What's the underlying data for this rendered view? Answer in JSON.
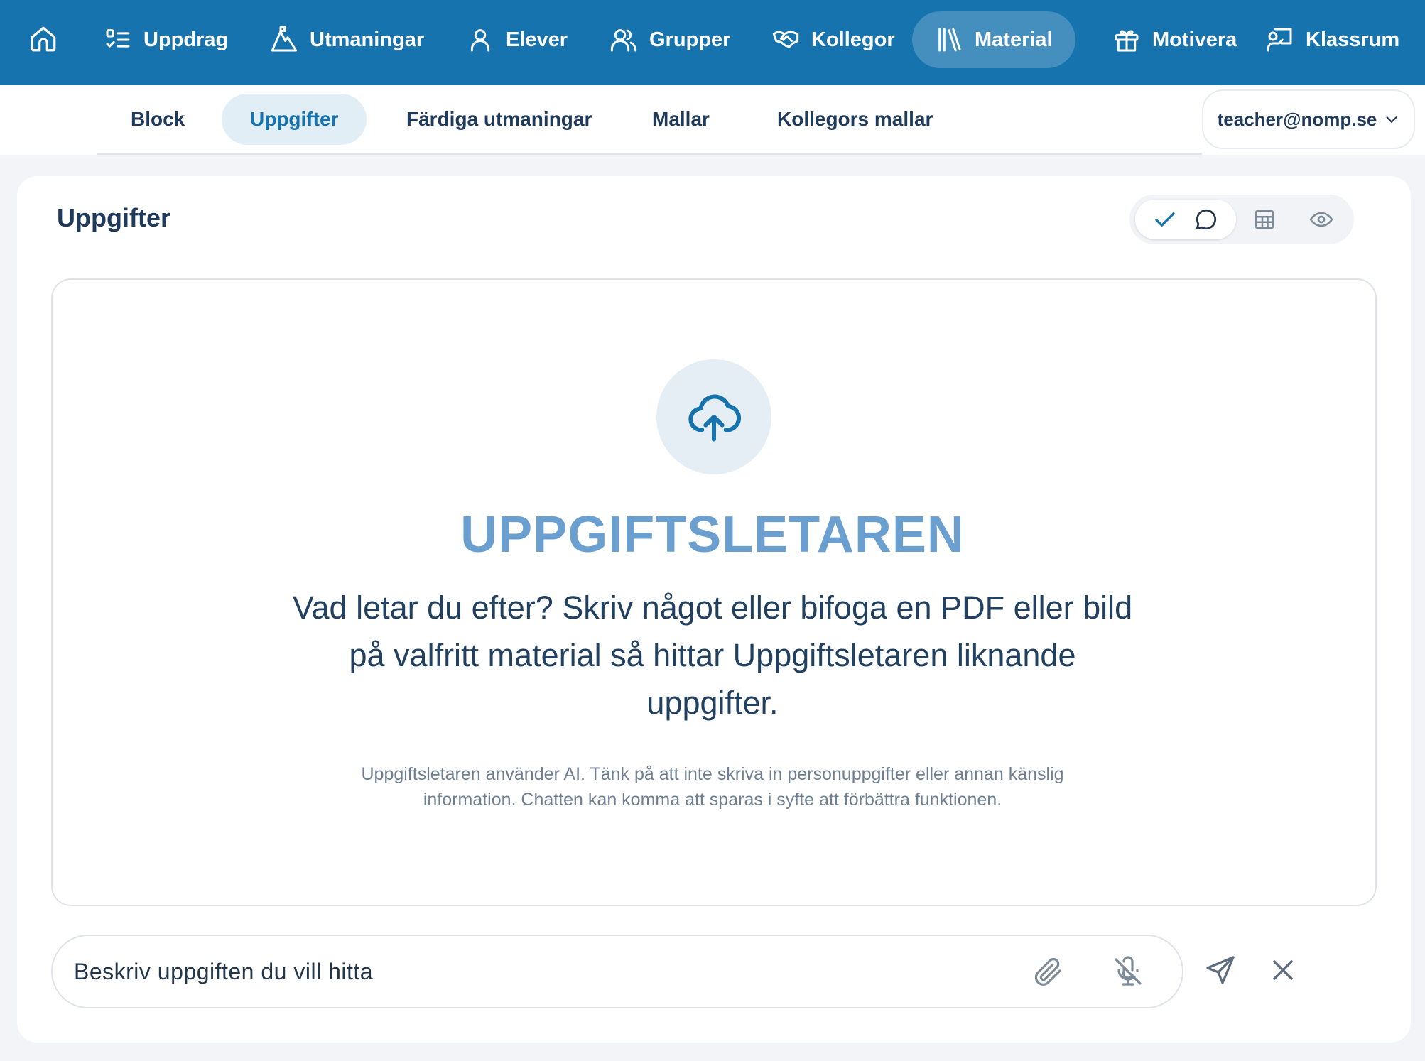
{
  "topnav": {
    "items": [
      {
        "label": "Uppdrag",
        "icon": "list-check-icon"
      },
      {
        "label": "Utmaningar",
        "icon": "mountain-icon"
      },
      {
        "label": "Elever",
        "icon": "user-icon"
      },
      {
        "label": "Grupper",
        "icon": "users-icon"
      },
      {
        "label": "Kollegor",
        "icon": "handshake-icon"
      },
      {
        "label": "Material",
        "icon": "library-icon",
        "active": true
      },
      {
        "label": "Motivera",
        "icon": "gift-icon"
      },
      {
        "label": "Klassrum",
        "icon": "presentation-icon"
      }
    ],
    "home_icon": "home-icon",
    "background": "#1673ad"
  },
  "subnav": {
    "tabs": [
      {
        "label": "Block"
      },
      {
        "label": "Uppgifter",
        "active": true
      },
      {
        "label": "Färdiga utmaningar"
      },
      {
        "label": "Mallar"
      },
      {
        "label": "Kollegors mallar"
      }
    ],
    "user_email": "teacher@nomp.se"
  },
  "main": {
    "title": "Uppgifter",
    "view_toggle": {
      "selected": "check-chat",
      "options": [
        "checkmark-icon",
        "chat-icon",
        "table-icon",
        "eye-icon"
      ]
    },
    "finder": {
      "icon": "cloud-upload-icon",
      "title": "UPPGIFTSLETAREN",
      "description": "Vad letar du efter? Skriv något eller bifoga en PDF eller bild på valfritt material så hittar Uppgiftsletaren liknande uppgifter.",
      "note": "Uppgiftsletaren använder AI. Tänk på att inte skriva in personuppgifter eller annan känslig information. Chatten kan komma att sparas i syfte att förbättra funktionen."
    },
    "input": {
      "value": "",
      "placeholder": "Beskriv uppgiften du vill hitta"
    }
  },
  "colors": {
    "accent": "#1673ad",
    "finder_title": "#6a9fd0",
    "text": "#1f3a5a",
    "page_bg": "#f3f4f8"
  }
}
